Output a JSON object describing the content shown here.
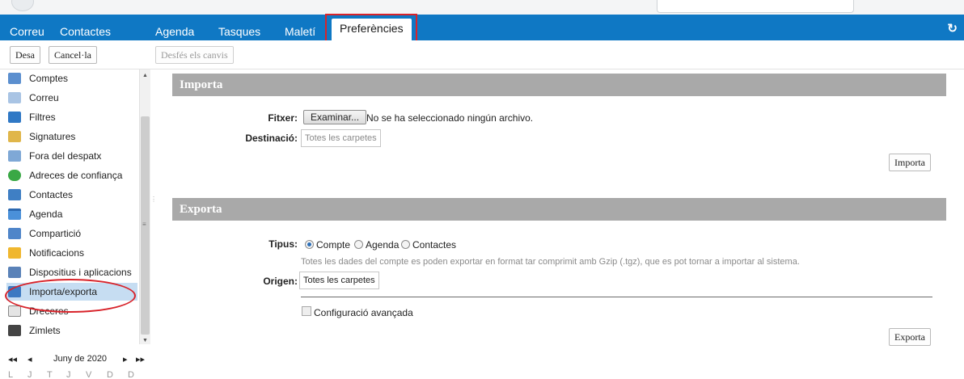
{
  "tabs": [
    {
      "label": "Correu"
    },
    {
      "label": "Contactes"
    },
    {
      "label": "Agenda"
    },
    {
      "label": "Tasques"
    },
    {
      "label": "Maletí"
    },
    {
      "label": "Preferències",
      "active": true
    }
  ],
  "toolbar": {
    "save_label": "Desa",
    "cancel_label": "Cancel·la",
    "undo_label": "Desfés els canvis"
  },
  "sidebar": {
    "items": [
      {
        "label": "Comptes",
        "icon": "accounts-icon"
      },
      {
        "label": "Correu",
        "icon": "mail-icon"
      },
      {
        "label": "Filtres",
        "icon": "filter-icon"
      },
      {
        "label": "Signatures",
        "icon": "signature-icon"
      },
      {
        "label": "Fora del despatx",
        "icon": "out-of-office-icon"
      },
      {
        "label": "Adreces de confiança",
        "icon": "shield-icon"
      },
      {
        "label": "Contactes",
        "icon": "contact-icon"
      },
      {
        "label": "Agenda",
        "icon": "calendar-icon"
      },
      {
        "label": "Compartició",
        "icon": "share-icon"
      },
      {
        "label": "Notificacions",
        "icon": "bell-icon"
      },
      {
        "label": "Dispositius i aplicacions",
        "icon": "device-icon"
      },
      {
        "label": "Importa/exporta",
        "icon": "import-export-icon",
        "selected": true
      },
      {
        "label": "Dreceres",
        "icon": "shortcut-icon"
      },
      {
        "label": "Zimlets",
        "icon": "zimlet-icon"
      }
    ],
    "calendar": {
      "month_label": "Juny de 2020",
      "weekdays": [
        "L",
        "J",
        "T",
        "J",
        "V",
        "D",
        "D"
      ]
    }
  },
  "import": {
    "title": "Importa",
    "file_label": "Fitxer:",
    "browse_label": "Examinar...",
    "no_file_text": "No se ha seleccionado ningún archivo.",
    "dest_label": "Destinació:",
    "dest_value": "Totes les carpetes",
    "button_label": "Importa"
  },
  "export": {
    "title": "Exporta",
    "type_label": "Tipus:",
    "options": [
      "Compte",
      "Agenda",
      "Contactes"
    ],
    "selected_option": "Compte",
    "hint": "Totes les dades del compte es poden exportar en format tar comprimit amb Gzip (.tgz), que es pot tornar a importar al sistema.",
    "origin_label": "Origen:",
    "origin_value": "Totes les carpetes",
    "advanced_label": "Configuració avançada",
    "button_label": "Exporta"
  },
  "colors": {
    "tabbar": "#0f78c4",
    "section_header": "#a9a9a9",
    "selection": "#c6ddf2",
    "annotation": "#d8232a"
  }
}
